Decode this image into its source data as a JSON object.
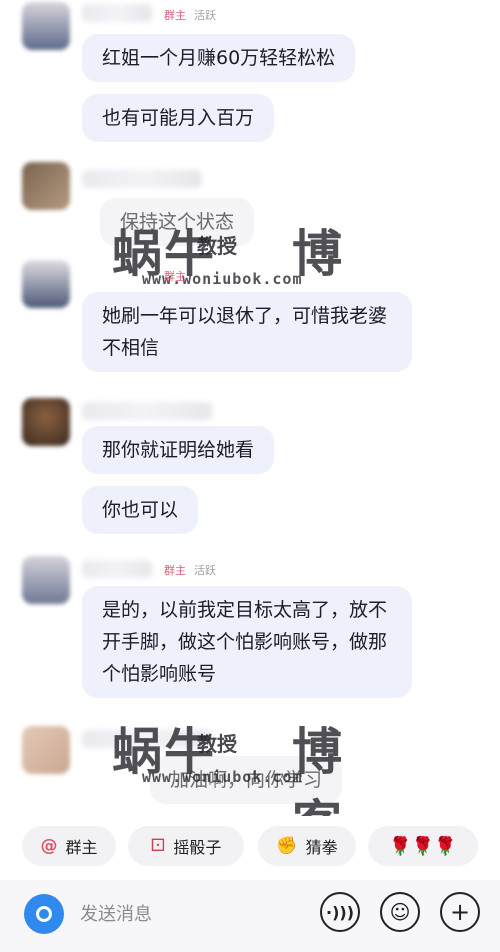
{
  "messages": [
    {
      "role": "群主",
      "status": "活跃",
      "text": "红姐一个月赚60万轻轻松松"
    },
    {
      "text": "也有可能月入百万"
    },
    {
      "text": "保持这个状态"
    },
    {
      "role": "群主",
      "text": "她刷一年可以退休了，可惜我老婆不相信"
    },
    {
      "text": "那你就证明给她看"
    },
    {
      "text": "你也可以"
    },
    {
      "role": "群主",
      "status": "活跃",
      "text": "是的，以前我定目标太高了，放不开手脚，做这个怕影响账号，做那个怕影响账号"
    },
    {
      "text": "加油啊，向你学习"
    }
  ],
  "watermark": {
    "brand": "蜗牛",
    "sub": "教授",
    "brand2": "博客",
    "url": "www.woniubok.com"
  },
  "quick_actions": [
    {
      "icon": "@",
      "label": "群主"
    },
    {
      "icon": "⚀",
      "label": "摇骰子"
    },
    {
      "icon": "✊",
      "label": "猜拳"
    },
    {
      "icon": "🌹🌹🌹",
      "label": ""
    }
  ],
  "input": {
    "placeholder": "发送消息"
  },
  "colors": {
    "bubble": "#eef0fb",
    "accent": "#2f89ee",
    "role": "#e0607a"
  }
}
